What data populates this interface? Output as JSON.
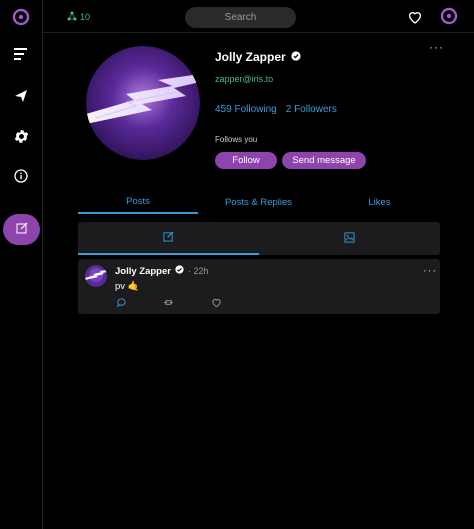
{
  "sidebar": {
    "items": [
      {
        "icon": "iris-logo-icon"
      },
      {
        "icon": "menu-icon"
      },
      {
        "icon": "send-icon"
      },
      {
        "icon": "gear-icon"
      },
      {
        "icon": "info-icon"
      },
      {
        "icon": "new-post-icon"
      }
    ]
  },
  "header": {
    "relay_count": "10",
    "search_placeholder": "Search"
  },
  "profile": {
    "name": "Jolly Zapper",
    "nip05": "zapper@iris.to",
    "following_count": "459",
    "following_label": "Following",
    "followers_count": "2",
    "followers_label": "Followers",
    "follows_you": "Follows you",
    "follow_button": "Follow",
    "message_button": "Send message",
    "more": "···"
  },
  "tabs": [
    {
      "label": "Posts",
      "active": true
    },
    {
      "label": "Posts & Replies",
      "active": false
    },
    {
      "label": "Likes",
      "active": false
    }
  ],
  "post": {
    "author": "Jolly Zapper",
    "time": "· 22h",
    "text": "pv 🤙",
    "more": "···"
  },
  "colors": {
    "accent": "#8e44ad",
    "link": "#3a9bdc",
    "nip05": "#3fbf7f",
    "card": "#1c1c1e"
  }
}
